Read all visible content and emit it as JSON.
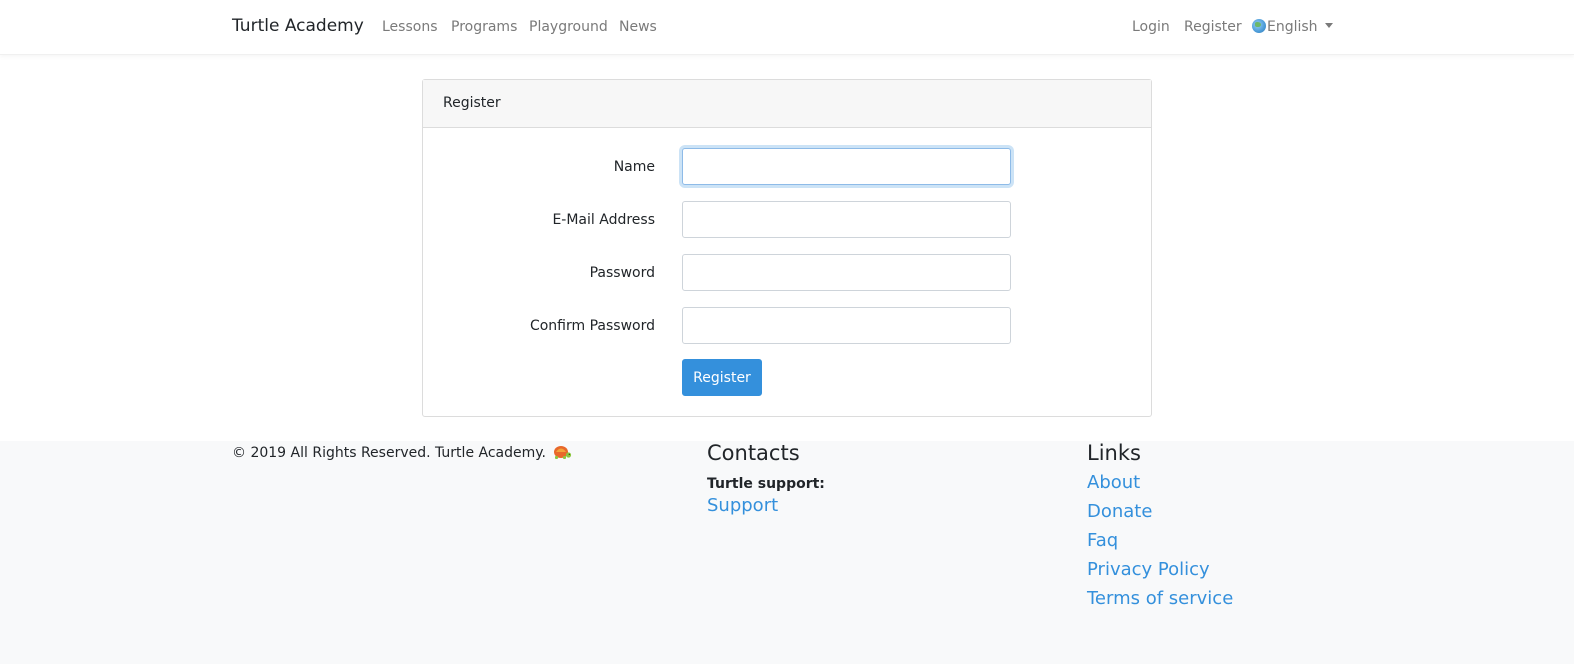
{
  "navbar": {
    "brand": "Turtle Academy",
    "links": [
      "Lessons",
      "Programs",
      "Playground",
      "News"
    ],
    "login": "Login",
    "register": "Register",
    "language": "English"
  },
  "card": {
    "header": "Register",
    "fields": [
      {
        "label": "Name",
        "value": "",
        "type": "text"
      },
      {
        "label": "E-Mail Address",
        "value": "",
        "type": "email"
      },
      {
        "label": "Password",
        "value": "",
        "type": "password"
      },
      {
        "label": "Confirm Password",
        "value": "",
        "type": "password"
      }
    ],
    "submit_label": "Register"
  },
  "footer": {
    "copyright": "©  2019 All Rights Reserved. Turtle Academy.",
    "contacts_heading": "Contacts",
    "support_label": "Turtle support:",
    "support_link": "Support",
    "links_heading": "Links",
    "links": [
      "About",
      "Donate",
      "Faq",
      "Privacy Policy",
      "Terms of service"
    ]
  },
  "colors": {
    "accent": "#3490dc",
    "footer_bg": "#f8f9fa",
    "nav_link": "#7a7a7a"
  },
  "icons": [
    "globe-icon",
    "caret-down-icon",
    "turtle-logo-icon"
  ]
}
